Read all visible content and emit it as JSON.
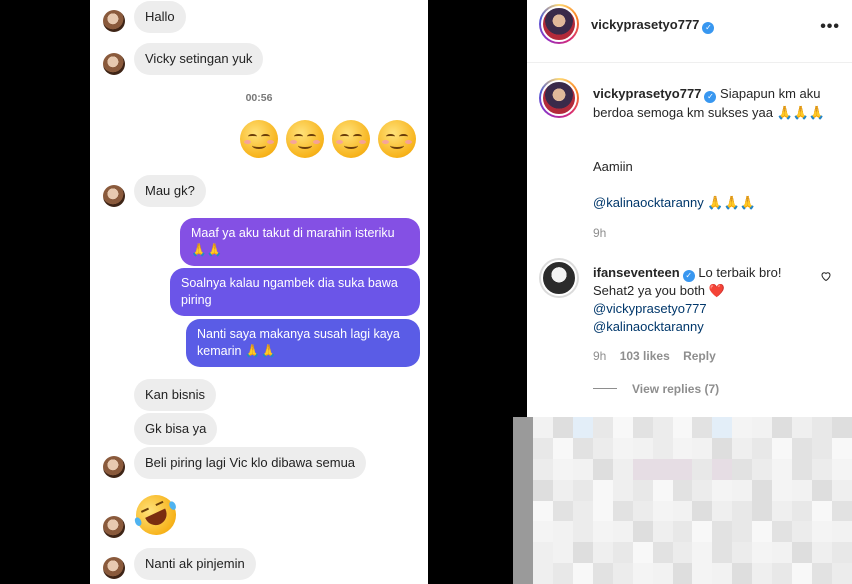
{
  "chat": {
    "messages_in_top": [
      {
        "text": "Hallo"
      },
      {
        "text": "Vicky setingan yuk"
      }
    ],
    "timestamp": "00:56",
    "emoji_reply": [
      "smiling-face-icon",
      "smiling-face-icon",
      "smiling-face-icon",
      "smiling-face-icon"
    ],
    "mau_gk": "Mau gk?",
    "outgoing": [
      "Maaf ya aku takut di marahin isteriku 🙏🙏",
      "Soalnya kalau ngambek dia suka bawa piring",
      "Nanti saya makanya susah lagi kaya kemarin 🙏🙏"
    ],
    "incoming_bottom": [
      "Kan bisnis",
      "Gk bisa ya",
      "Beli piring lagi Vic klo dibawa semua"
    ],
    "laugh_emoji": "rolling-on-floor-laughing-icon",
    "last_message": "Nanti ak pinjemin"
  },
  "instagram": {
    "header_username": "vickyprasetyo777",
    "more_label": "•••",
    "caption": {
      "username": "vickyprasetyo777",
      "text": "Siapapun km aku berdoa semoga km sukses yaa 🙏🙏🙏",
      "line2": "Aamiin",
      "mention": "@kalinaocktaranny",
      "mention_suffix": " 🙏🙏🙏",
      "time": "9h"
    },
    "comment": {
      "username": "ifanseventeen",
      "text": "Lo terbaik bro!",
      "line2": "Sehat2 ya you both ❤️",
      "mention1": "@vickyprasetyo777",
      "mention2": "@kalinaocktaranny",
      "time": "9h",
      "likes": "103 likes",
      "reply": "Reply",
      "view_replies": "View replies (7)"
    }
  },
  "colors": {
    "bubble_purple_1": "#8450e4",
    "bubble_purple_2": "#6b55e8",
    "bubble_purple_3": "#5a5ce6",
    "link": "#00376b",
    "verified": "#3897f0"
  }
}
